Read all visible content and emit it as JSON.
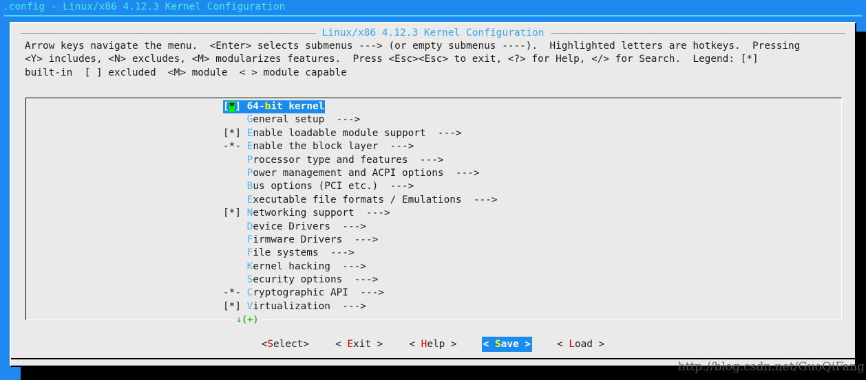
{
  "window": {
    "title": ".config - Linux/x86 4.12.3 Kernel Configuration"
  },
  "dialog": {
    "title": "Linux/x86 4.12.3 Kernel Configuration",
    "help_lines": [
      "Arrow keys navigate the menu.  <Enter> selects submenus ---> (or empty submenus ----).  Highlighted letters are hotkeys.  Pressing",
      "<Y> includes, <N> excludes, <M> modularizes features.  Press <Esc><Esc> to exit, <?> for Help, </> for Search.  Legend: [*]",
      "built-in  [ ] excluded  <M> module  < > module capable"
    ]
  },
  "menu": {
    "scroll_marker": "↓(+)",
    "items": [
      {
        "prefix": "[*] ",
        "hotkey": "",
        "pre": "64-",
        "hot": "b",
        "post": "it kernel",
        "arrow": "",
        "selected": true
      },
      {
        "prefix": "    ",
        "hotkey": "G",
        "pre": "",
        "hot": "G",
        "post": "eneral setup",
        "arrow": "  --->",
        "selected": false
      },
      {
        "prefix": "[*] ",
        "hotkey": "E",
        "pre": "",
        "hot": "E",
        "post": "nable loadable module support",
        "arrow": "  --->",
        "selected": false
      },
      {
        "prefix": "-*- ",
        "hotkey": "E",
        "pre": "",
        "hot": "E",
        "post": "nable the block layer",
        "arrow": "  --->",
        "selected": false
      },
      {
        "prefix": "    ",
        "hotkey": "P",
        "pre": "",
        "hot": "P",
        "post": "rocessor type and features",
        "arrow": "  --->",
        "selected": false
      },
      {
        "prefix": "    ",
        "hotkey": "P",
        "pre": "",
        "hot": "P",
        "post": "ower management and ACPI options",
        "arrow": "  --->",
        "selected": false
      },
      {
        "prefix": "    ",
        "hotkey": "B",
        "pre": "",
        "hot": "B",
        "post": "us options (PCI etc.)",
        "arrow": "  --->",
        "selected": false
      },
      {
        "prefix": "    ",
        "hotkey": "E",
        "pre": "",
        "hot": "E",
        "post": "xecutable file formats / Emulations",
        "arrow": "  --->",
        "selected": false
      },
      {
        "prefix": "[*] ",
        "hotkey": "N",
        "pre": "",
        "hot": "N",
        "post": "etworking support",
        "arrow": "  --->",
        "selected": false
      },
      {
        "prefix": "    ",
        "hotkey": "D",
        "pre": "",
        "hot": "D",
        "post": "evice Drivers",
        "arrow": "  --->",
        "selected": false
      },
      {
        "prefix": "    ",
        "hotkey": "F",
        "pre": "",
        "hot": "F",
        "post": "irmware Drivers",
        "arrow": "  --->",
        "selected": false
      },
      {
        "prefix": "    ",
        "hotkey": "F",
        "pre": "",
        "hot": "F",
        "post": "ile systems",
        "arrow": "  --->",
        "selected": false
      },
      {
        "prefix": "    ",
        "hotkey": "K",
        "pre": "",
        "hot": "K",
        "post": "ernel hacking",
        "arrow": "  --->",
        "selected": false
      },
      {
        "prefix": "    ",
        "hotkey": "S",
        "pre": "",
        "hot": "S",
        "post": "ecurity options",
        "arrow": "  --->",
        "selected": false
      },
      {
        "prefix": "-*- ",
        "hotkey": "C",
        "pre": "",
        "hot": "C",
        "post": "ryptographic API",
        "arrow": "  --->",
        "selected": false
      },
      {
        "prefix": "[*] ",
        "hotkey": "V",
        "pre": "",
        "hot": "V",
        "post": "irtualization",
        "arrow": "  --->",
        "selected": false
      }
    ]
  },
  "buttons": [
    {
      "pre": "<",
      "hot": "S",
      "post": "elect>",
      "selected": false,
      "name": "select"
    },
    {
      "pre": "< ",
      "hot": "E",
      "post": "xit >",
      "selected": false,
      "name": "exit"
    },
    {
      "pre": "< ",
      "hot": "H",
      "post": "elp >",
      "selected": false,
      "name": "help"
    },
    {
      "pre": "< ",
      "hot": "S",
      "post": "ave >",
      "selected": true,
      "name": "save"
    },
    {
      "pre": "< ",
      "hot": "L",
      "post": "oad >",
      "selected": false,
      "name": "load"
    }
  ],
  "watermark": "http://blog.csdn.net/GuoQiFang",
  "colors": {
    "desktop_blue": "#2089f0",
    "title_cyan": "#3cf0f0",
    "dialog_title_blue": "#3ba2f5",
    "dialog_bg": "#eaeaea",
    "hotkey_blue": "#4fb3f5",
    "hotkey_red": "#cc0000",
    "select_bg": "#1a8cf0",
    "select_hotkey": "#ffff00",
    "star_green": "#00f000",
    "scroll_green": "#2fc22f"
  }
}
